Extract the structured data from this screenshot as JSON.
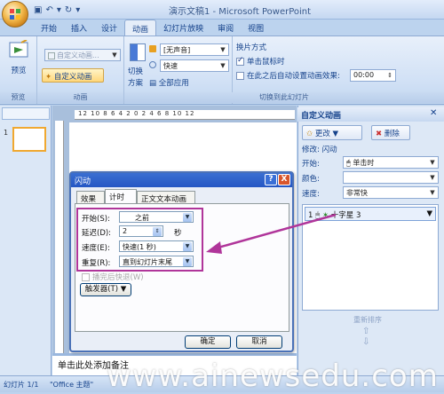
{
  "window": {
    "title": "演示文稿1 - Microsoft PowerPoint"
  },
  "ribbon": {
    "tabs": [
      "开始",
      "插入",
      "设计",
      "动画",
      "幻灯片放映",
      "审阅",
      "视图"
    ],
    "active_tab": "动画",
    "preview_group": {
      "button": "预览",
      "label": "预览"
    },
    "animation_group": {
      "animate_combo": "自定义动画...",
      "custom_animation_button": "自定义动画",
      "label": "动画"
    },
    "transition_group": {
      "scheme_button_line1": "切换",
      "scheme_button_line2": "方案",
      "sound_combo": "[无声音]",
      "speed_combo": "快速",
      "apply_all": "全部应用",
      "label": "切换到此幻灯片"
    },
    "advance_group": {
      "title": "换片方式",
      "on_click": "单击鼠标时",
      "auto_after": "在此之后自动设置动画效果:",
      "time_value": "00:00"
    }
  },
  "slides_pane": {
    "slide_number": "1"
  },
  "ruler": {
    "marks": "12 10 8 6 4 2 0 2 4 6 8 10 12"
  },
  "notes": {
    "text": "单击此处添加备注"
  },
  "custom_animation_pane": {
    "title": "自定义动画",
    "change_button": "更改",
    "remove_button": "删除",
    "modify_label": "修改: 闪动",
    "start_label": "开始:",
    "start_value": "单击时",
    "color_label": "颜色:",
    "color_value": "",
    "speed_label": "速度:",
    "speed_value": "非常快",
    "list_item": {
      "index": "1",
      "name": "十字星 3"
    },
    "reorder_label": "重新排序"
  },
  "dialog": {
    "title": "闪动",
    "help_button": "?",
    "close_button": "X",
    "tabs": [
      "效果",
      "计时",
      "正文文本动画"
    ],
    "active_tab": "计时",
    "start_label": "开始(S):",
    "start_value": "之前",
    "delay_label": "延迟(D):",
    "delay_value": "2",
    "delay_unit": "秒",
    "speed_label": "速度(E):",
    "speed_value": "快速(1 秒)",
    "repeat_label": "重复(R):",
    "repeat_value": "直到幻灯片末尾",
    "rewind_label": "播完后快退(W)",
    "triggers_button": "触发器(T)",
    "ok_button": "确定",
    "cancel_button": "取消"
  },
  "status_bar": {
    "slide_info": "幻灯片 1/1",
    "theme": "\"Office 主题\""
  },
  "watermark": {
    "text": "www.ainewsedu.com"
  },
  "colors": {
    "highlight_box": "#b0359a",
    "arrow": "#b0359a",
    "dialog_title": "#2456c4"
  }
}
